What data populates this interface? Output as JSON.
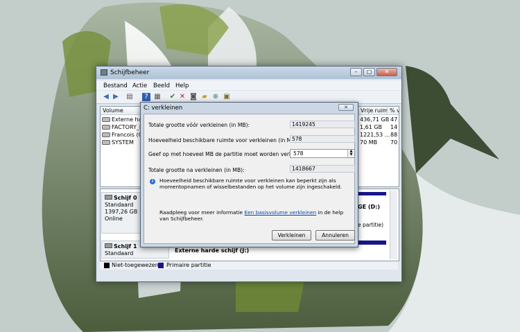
{
  "main_window": {
    "title": "Schijfbeheer",
    "controls": {
      "minimize": "–",
      "maximize": "□",
      "close": "✕"
    },
    "menu": [
      "Bestand",
      "Actie",
      "Beeld",
      "Help"
    ],
    "volume_table": {
      "headers": [
        "Volume",
        "Vrije ruim",
        "% v"
      ],
      "rows": [
        {
          "name": "Externe harc",
          "free": "436,71 GB",
          "pct": "47"
        },
        {
          "name": "FACTORY_IN",
          "free": "1,61 GB",
          "pct": "14"
        },
        {
          "name": "Francois (C:",
          "free": "1221,53 ...",
          "pct": "88"
        },
        {
          "name": "SYSTEM",
          "free": "70 MB",
          "pct": "70"
        }
      ]
    },
    "disks": [
      {
        "name": "Schijf 0",
        "type": "Standaard",
        "size": "1397,26 GB",
        "status": "Online",
        "partition_fragment": "GE  (D:)",
        "partition_fragment2": "e partitie)"
      },
      {
        "name": "Schijf 1",
        "type": "Standaard",
        "partition_label": "Externe harde schijf  (J:)"
      }
    ],
    "legend": [
      {
        "label": "Niet-toegewezen",
        "color": "#000000"
      },
      {
        "label": "Primaire partitie",
        "color": "#16168a"
      }
    ]
  },
  "dialog": {
    "title": "C: verkleinen",
    "close": "✕",
    "fields": [
      {
        "label": "Totale grootte vóór verkleinen (in MB):",
        "value": "1419245"
      },
      {
        "label": "Hoeveelheid beschikbare ruimte voor verkleinen (in MB):",
        "value": "578"
      },
      {
        "label": "Geef op met hoeveel MB de partitie moet worden verkleind:",
        "value": "578"
      },
      {
        "label": "Totale grootte na verkleinen (in MB):",
        "value": "1418667"
      }
    ],
    "info": "Hoeveelheid beschikbare ruimte voor verkleinen kan beperkt zijn als momentopnamen of wisselbestanden op het volume zijn ingeschakeld.",
    "help_prefix": "Raadpleeg voor meer informatie ",
    "help_link": "Een basisvolume verkleinen",
    "help_suffix": " in de help van Schijfbeheer.",
    "buttons": {
      "shrink": "Verkleinen",
      "cancel": "Annuleren"
    }
  },
  "colors": {
    "accent": "#2d6fd1",
    "primary_partition": "#16168a",
    "link": "#0645ad"
  }
}
